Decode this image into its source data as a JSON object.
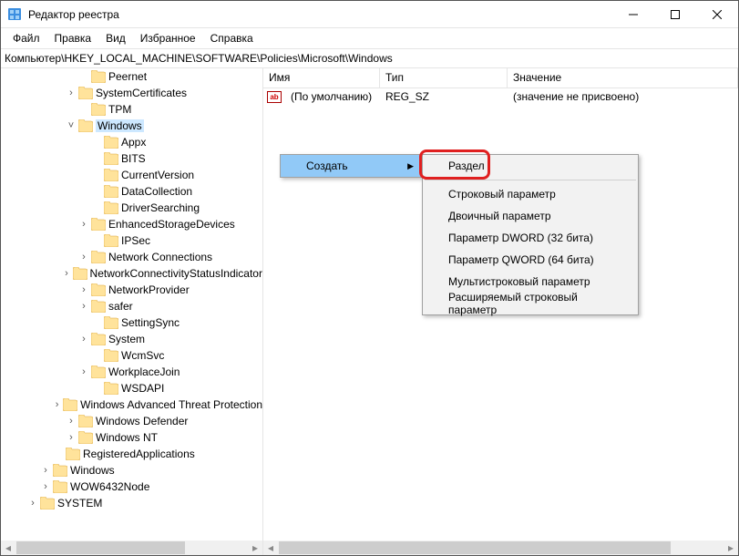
{
  "window": {
    "title": "Редактор реестра"
  },
  "menu": {
    "file": "Файл",
    "edit": "Правка",
    "view": "Вид",
    "fav": "Избранное",
    "help": "Справка"
  },
  "address": "Компьютер\\HKEY_LOCAL_MACHINE\\SOFTWARE\\Policies\\Microsoft\\Windows",
  "tree": [
    {
      "d": 6,
      "tw": "",
      "n": "Peernet"
    },
    {
      "d": 5,
      "tw": ">",
      "n": "SystemCertificates"
    },
    {
      "d": 6,
      "tw": "",
      "n": "TPM"
    },
    {
      "d": 5,
      "tw": "v",
      "n": "Windows",
      "sel": true
    },
    {
      "d": 7,
      "tw": "",
      "n": "Appx"
    },
    {
      "d": 7,
      "tw": "",
      "n": "BITS"
    },
    {
      "d": 7,
      "tw": "",
      "n": "CurrentVersion"
    },
    {
      "d": 7,
      "tw": "",
      "n": "DataCollection"
    },
    {
      "d": 7,
      "tw": "",
      "n": "DriverSearching"
    },
    {
      "d": 6,
      "tw": ">",
      "n": "EnhancedStorageDevices"
    },
    {
      "d": 7,
      "tw": "",
      "n": "IPSec"
    },
    {
      "d": 6,
      "tw": ">",
      "n": "Network Connections"
    },
    {
      "d": 6,
      "tw": ">",
      "n": "NetworkConnectivityStatusIndicator"
    },
    {
      "d": 6,
      "tw": ">",
      "n": "NetworkProvider"
    },
    {
      "d": 6,
      "tw": ">",
      "n": "safer"
    },
    {
      "d": 7,
      "tw": "",
      "n": "SettingSync"
    },
    {
      "d": 6,
      "tw": ">",
      "n": "System"
    },
    {
      "d": 7,
      "tw": "",
      "n": "WcmSvc"
    },
    {
      "d": 6,
      "tw": ">",
      "n": "WorkplaceJoin"
    },
    {
      "d": 7,
      "tw": "",
      "n": "WSDAPI"
    },
    {
      "d": 5,
      "tw": ">",
      "n": "Windows Advanced Threat Protection"
    },
    {
      "d": 5,
      "tw": ">",
      "n": "Windows Defender"
    },
    {
      "d": 5,
      "tw": ">",
      "n": "Windows NT"
    },
    {
      "d": 4,
      "tw": "",
      "n": "RegisteredApplications"
    },
    {
      "d": 3,
      "tw": ">",
      "n": "Windows"
    },
    {
      "d": 3,
      "tw": ">",
      "n": "WOW6432Node"
    },
    {
      "d": 2,
      "tw": ">",
      "n": "SYSTEM"
    }
  ],
  "cols": {
    "name": "Имя",
    "type": "Тип",
    "data": "Значение"
  },
  "row": {
    "name": "(По умолчанию)",
    "type": "REG_SZ",
    "data": "(значение не присвоено)"
  },
  "ctx": {
    "create": "Создать",
    "items": [
      "Раздел",
      "Строковый параметр",
      "Двоичный параметр",
      "Параметр DWORD (32 бита)",
      "Параметр QWORD (64 бита)",
      "Мультистроковый параметр",
      "Расширяемый строковый параметр"
    ]
  }
}
